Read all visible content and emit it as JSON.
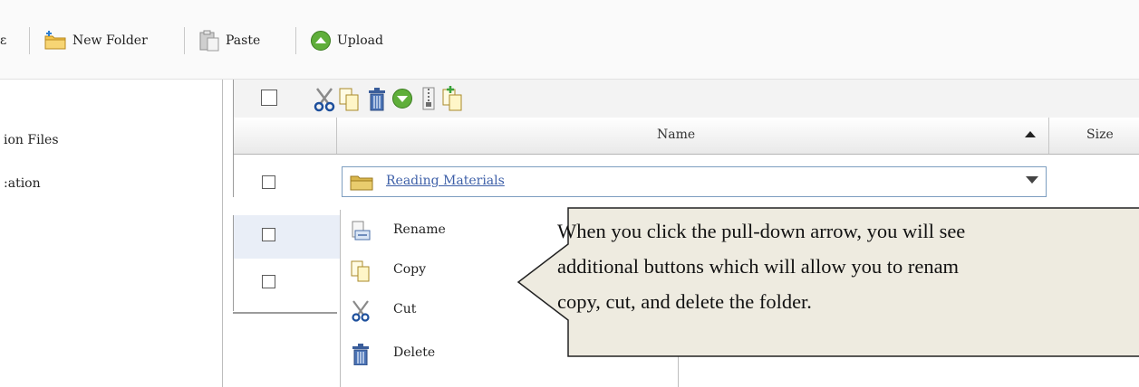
{
  "toolbar": {
    "items": [
      {
        "label": "New Folder",
        "icon": "new-folder-icon"
      },
      {
        "label": "Paste",
        "icon": "paste-icon"
      },
      {
        "label": "Upload",
        "icon": "upload-icon"
      }
    ]
  },
  "tree": {
    "items": [
      {
        "label": "ion Files"
      },
      {
        "label": ":ation"
      }
    ]
  },
  "grid": {
    "toolbar_icons": [
      "select-all-checkbox",
      "cut-icon",
      "copy-icon",
      "delete-icon",
      "download-icon",
      "zip-icon",
      "copy-to-icon"
    ],
    "columns": [
      {
        "label": "Name",
        "sort": "ascending"
      },
      {
        "label": "Size"
      }
    ],
    "rows": [
      {
        "name": "Reading Materials",
        "type": "folder"
      }
    ]
  },
  "menu": {
    "items": [
      {
        "label": "Rename",
        "icon": "rename-icon"
      },
      {
        "label": "Copy",
        "icon": "copy-icon"
      },
      {
        "label": "Cut",
        "icon": "cut-icon"
      },
      {
        "label": "Delete",
        "icon": "delete-icon"
      }
    ]
  },
  "callout": {
    "lines": [
      "When you click the pull-down arrow, you will see",
      "additional buttons which will allow you to renam",
      "copy, cut, and delete the folder."
    ]
  },
  "colors": {
    "link": "#3d5fa8",
    "upload_green": "#5fae3a",
    "callout_bg": "#eeebe0",
    "row_highlight": "#e9eef7"
  }
}
